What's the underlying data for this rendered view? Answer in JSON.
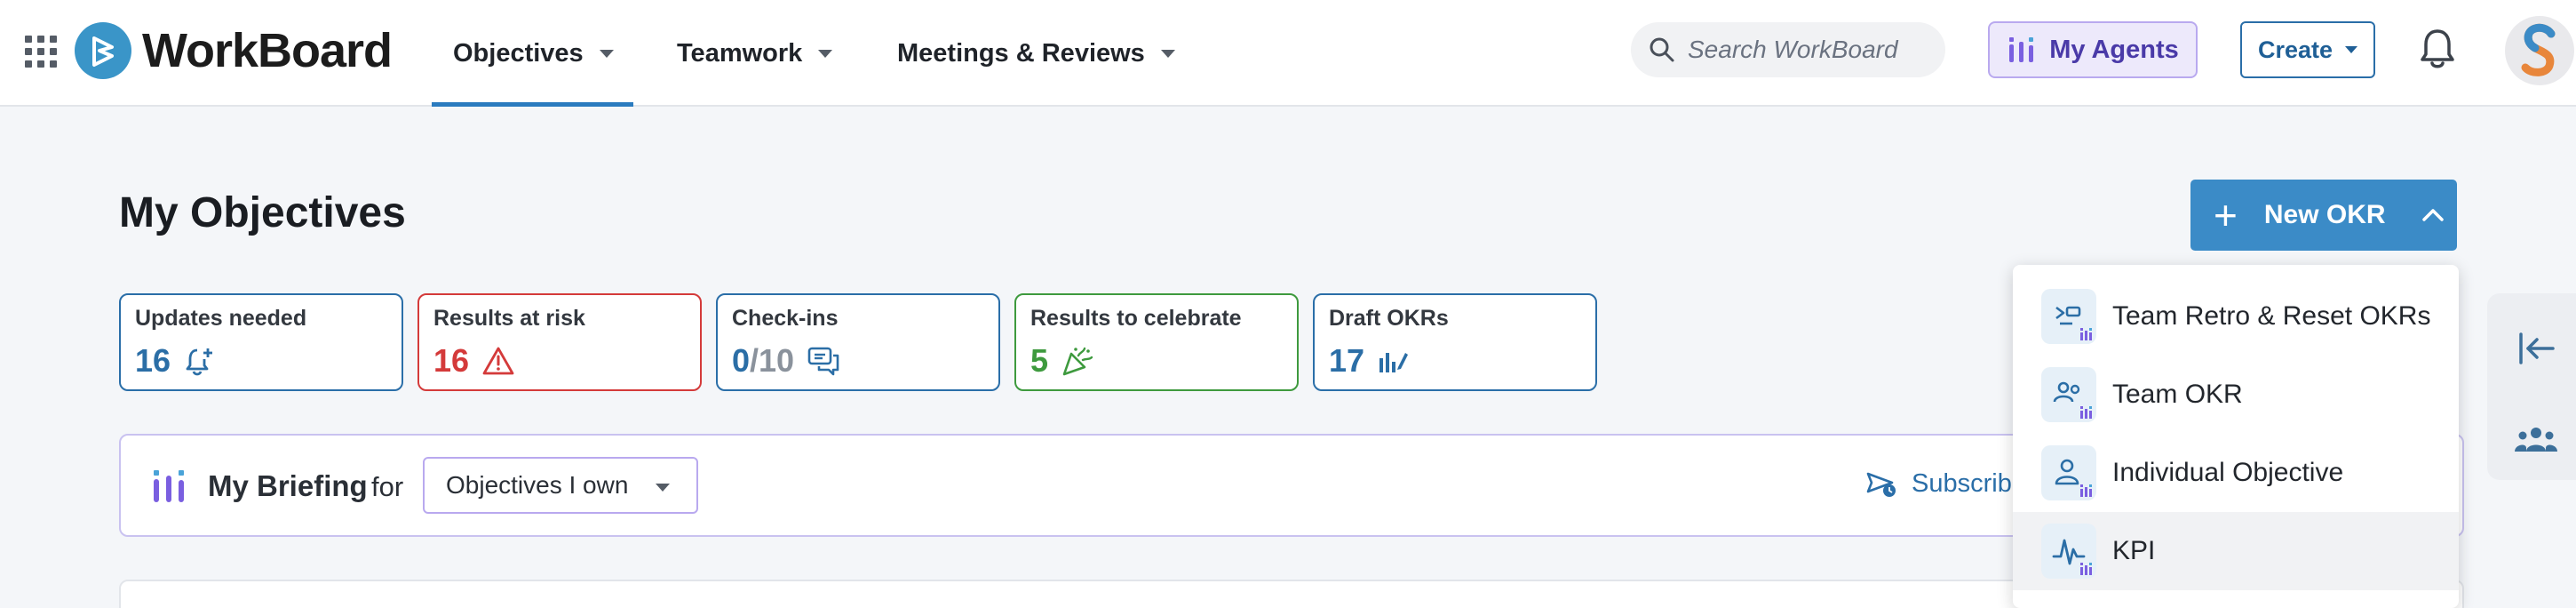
{
  "header": {
    "brand": "WorkBoard",
    "nav": [
      {
        "label": "Objectives",
        "active": true
      },
      {
        "label": "Teamwork",
        "active": false
      },
      {
        "label": "Meetings & Reviews",
        "active": false
      }
    ],
    "search_placeholder": "Search WorkBoard",
    "agents_label": "My Agents",
    "create_label": "Create",
    "avatar_initial": "S"
  },
  "main": {
    "title": "My Objectives",
    "new_okr_label": "New OKR",
    "cards": [
      {
        "label": "Updates needed",
        "value": "16",
        "icon": "bell-plus-icon"
      },
      {
        "label": "Results at risk",
        "value": "16",
        "icon": "warning-icon"
      },
      {
        "label": "Check-ins",
        "value": "0",
        "value_total": "/10",
        "icon": "chat-icon"
      },
      {
        "label": "Results to celebrate",
        "value": "5",
        "icon": "party-popper-icon"
      },
      {
        "label": "Draft OKRs",
        "value": "17",
        "icon": "draft-chart-icon"
      }
    ],
    "briefing": {
      "title": "My Briefing",
      "for_label": "for",
      "filter_value": "Objectives I own",
      "subscribe_label": "Subscribe"
    }
  },
  "new_okr_menu": {
    "items": [
      {
        "label": "Team Retro & Reset OKRs",
        "icon": "retro-reset-icon"
      },
      {
        "label": "Team OKR",
        "icon": "team-icon"
      },
      {
        "label": "Individual Objective",
        "icon": "person-icon"
      },
      {
        "label": "KPI",
        "icon": "kpi-pulse-icon",
        "hover": true
      }
    ]
  },
  "colors": {
    "primary": "#3b8bc7",
    "nav_active": "#2a7bbf",
    "risk": "#d43a3a",
    "celebrate": "#3e9a3e",
    "agent": "#7a5fe0"
  }
}
